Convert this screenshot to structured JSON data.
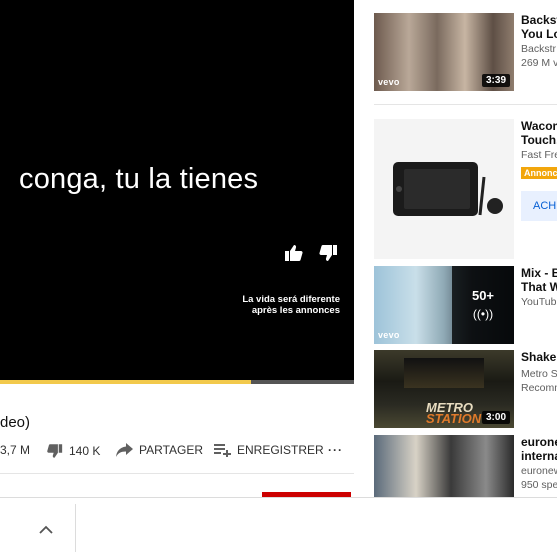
{
  "player": {
    "caption": "conga, tu la tienes",
    "ad_note_line1": "La vida será diferente",
    "ad_note_line2": "après les annonces",
    "progress_fraction": 0.71
  },
  "video": {
    "title_fragment": "deo)",
    "views_fragment": "3,7 M",
    "dislikes": "140 K",
    "share_label": "PARTAGER",
    "save_label": "ENREGISTRER",
    "more_label": "···"
  },
  "sidebar": {
    "items": [
      {
        "title1": "Backst",
        "title2": "You Lo",
        "sub1": "Backstr",
        "sub2": "269 M v",
        "duration": "3:39",
        "badge": "vevo"
      },
      {
        "title1": "Wacom",
        "title2": "Touch..",
        "sub1": "Fast Fre",
        "ad_label": "Annonce",
        "cta": "ACH"
      },
      {
        "title1": "Mix - B",
        "title2": "That W",
        "sub1": "YouTub",
        "count": "50+",
        "badge": "vevo"
      },
      {
        "title1": "Shake",
        "sub1": "Metro S",
        "sub2": "Recomm",
        "duration": "3:00",
        "logo_line1": "METRO",
        "logo_line2": "STATION"
      },
      {
        "title1": "eurone",
        "title2": "interna",
        "sub1": "euronew",
        "sub2": "950 spe"
      }
    ]
  },
  "colors": {
    "progress": "#f2c94c",
    "ad_badge": "#f2a60c",
    "cta_text": "#065fd4",
    "subscribe": "#cc0000"
  }
}
